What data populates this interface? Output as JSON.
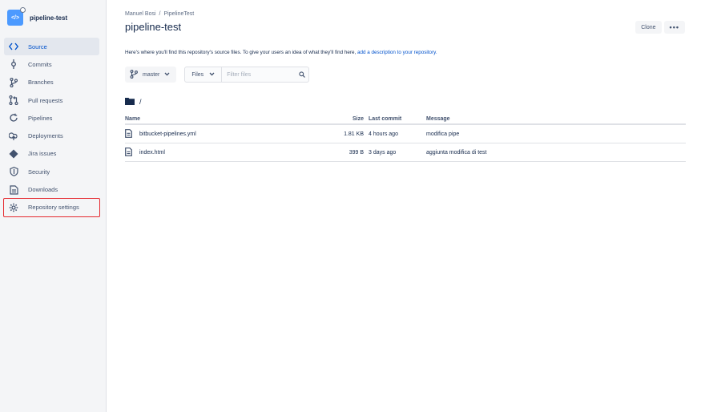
{
  "repo": {
    "name": "pipeline-test",
    "avatar_glyph": "</>"
  },
  "sidebar": {
    "items": [
      {
        "label": "Source",
        "icon": "source-icon",
        "active": true
      },
      {
        "label": "Commits",
        "icon": "commit-icon"
      },
      {
        "label": "Branches",
        "icon": "branch-icon"
      },
      {
        "label": "Pull requests",
        "icon": "pull-request-icon"
      },
      {
        "label": "Pipelines",
        "icon": "pipelines-icon"
      },
      {
        "label": "Deployments",
        "icon": "deployments-icon"
      },
      {
        "label": "Jira issues",
        "icon": "jira-icon"
      },
      {
        "label": "Security",
        "icon": "shield-icon"
      },
      {
        "label": "Downloads",
        "icon": "downloads-icon"
      },
      {
        "label": "Repository settings",
        "icon": "gear-icon",
        "highlighted": true
      }
    ]
  },
  "breadcrumb": {
    "owner": "Manuel Bosi",
    "separator": "/",
    "project": "PipelineTest"
  },
  "page": {
    "title": "pipeline-test",
    "clone_label": "Clone",
    "more_label": "•••",
    "description": "Here's where you'll find this repository's source files. To give your users an idea of what they'll find here, ",
    "description_link": "add a description to your repository."
  },
  "controls": {
    "branch": "master",
    "files_label": "Files",
    "filter_placeholder": "Filter files"
  },
  "path": "/",
  "table": {
    "headers": {
      "name": "Name",
      "size": "Size",
      "last_commit": "Last commit",
      "message": "Message"
    },
    "rows": [
      {
        "name": "bitbucket-pipelines.yml",
        "size": "1.81 KB",
        "last_commit": "4 hours ago",
        "message": "modifica pipe"
      },
      {
        "name": "index.html",
        "size": "399 B",
        "last_commit": "3 days ago",
        "message": "aggiunta modifica di test"
      }
    ]
  },
  "colors": {
    "accent": "#0052cc",
    "highlight": "#e5292f",
    "sidebar_bg": "#f4f5f7",
    "repo_avatar": "#4c9aff"
  }
}
